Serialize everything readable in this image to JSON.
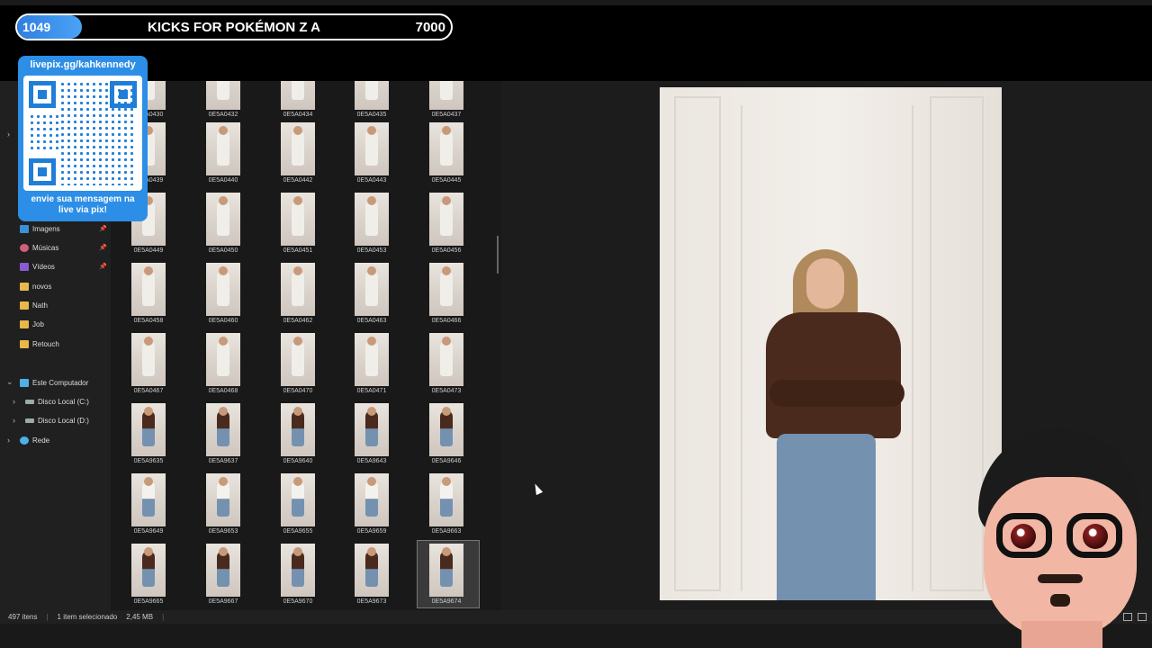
{
  "goal": {
    "current": "1049",
    "title": "KICKS FOR POKÉMON Z A",
    "target": "7000",
    "progress_fraction": 0.15
  },
  "qr": {
    "url_text": "livepix.gg/kahkennedy",
    "message_line1": "envie sua mensagem na",
    "message_line2": "live via pix!"
  },
  "nav": {
    "quick_access": [
      {
        "label": "Imagens",
        "icon": "image-icon",
        "pinned": true
      },
      {
        "label": "Músicas",
        "icon": "music-icon",
        "pinned": true
      },
      {
        "label": "Vídeos",
        "icon": "video-icon",
        "pinned": true
      },
      {
        "label": "novos",
        "icon": "folder-icon",
        "pinned": false
      },
      {
        "label": "Nath",
        "icon": "folder-icon",
        "pinned": false
      },
      {
        "label": "Job",
        "icon": "folder-icon",
        "pinned": false
      },
      {
        "label": "Retouch",
        "icon": "folder-icon",
        "pinned": false
      }
    ],
    "this_pc": "Este Computador",
    "drives": [
      "Disco Local (C:)",
      "Disco Local (D:)"
    ],
    "network": "Rede"
  },
  "files": {
    "rows": [
      [
        "0E5A0430",
        "0E5A0432",
        "0E5A0434",
        "0E5A0435",
        "0E5A0437"
      ],
      [
        "0E5A0439",
        "0E5A0440",
        "0E5A0442",
        "0E5A0443",
        "0E5A0445"
      ],
      [
        "0E5A0449",
        "0E5A0450",
        "0E5A0451",
        "0E5A0453",
        "0E5A0456"
      ],
      [
        "0E5A0458",
        "0E5A0460",
        "0E5A0462",
        "0E5A0463",
        "0E5A0466"
      ],
      [
        "0E5A0467",
        "0E5A0468",
        "0E5A0470",
        "0E5A0471",
        "0E5A0473"
      ],
      [
        "0E5A9635",
        "0E5A9637",
        "0E5A9640",
        "0E5A9643",
        "0E5A9646"
      ],
      [
        "0E5A9649",
        "0E5A9653",
        "0E5A9655",
        "0E5A9659",
        "0E5A9663"
      ],
      [
        "0E5A9665",
        "0E5A9667",
        "0E5A9670",
        "0E5A9673",
        "0E5A9674"
      ]
    ],
    "selected": "0E5A9674"
  },
  "status": {
    "item_count": "497 itens",
    "selection": "1 item selecionado",
    "size": "2,45 MB"
  },
  "colors": {
    "accent_blue": "#2c8ee6",
    "folder": "#e8b84a",
    "sweater": "#4a2a1c",
    "jeans": "#7591b0"
  }
}
